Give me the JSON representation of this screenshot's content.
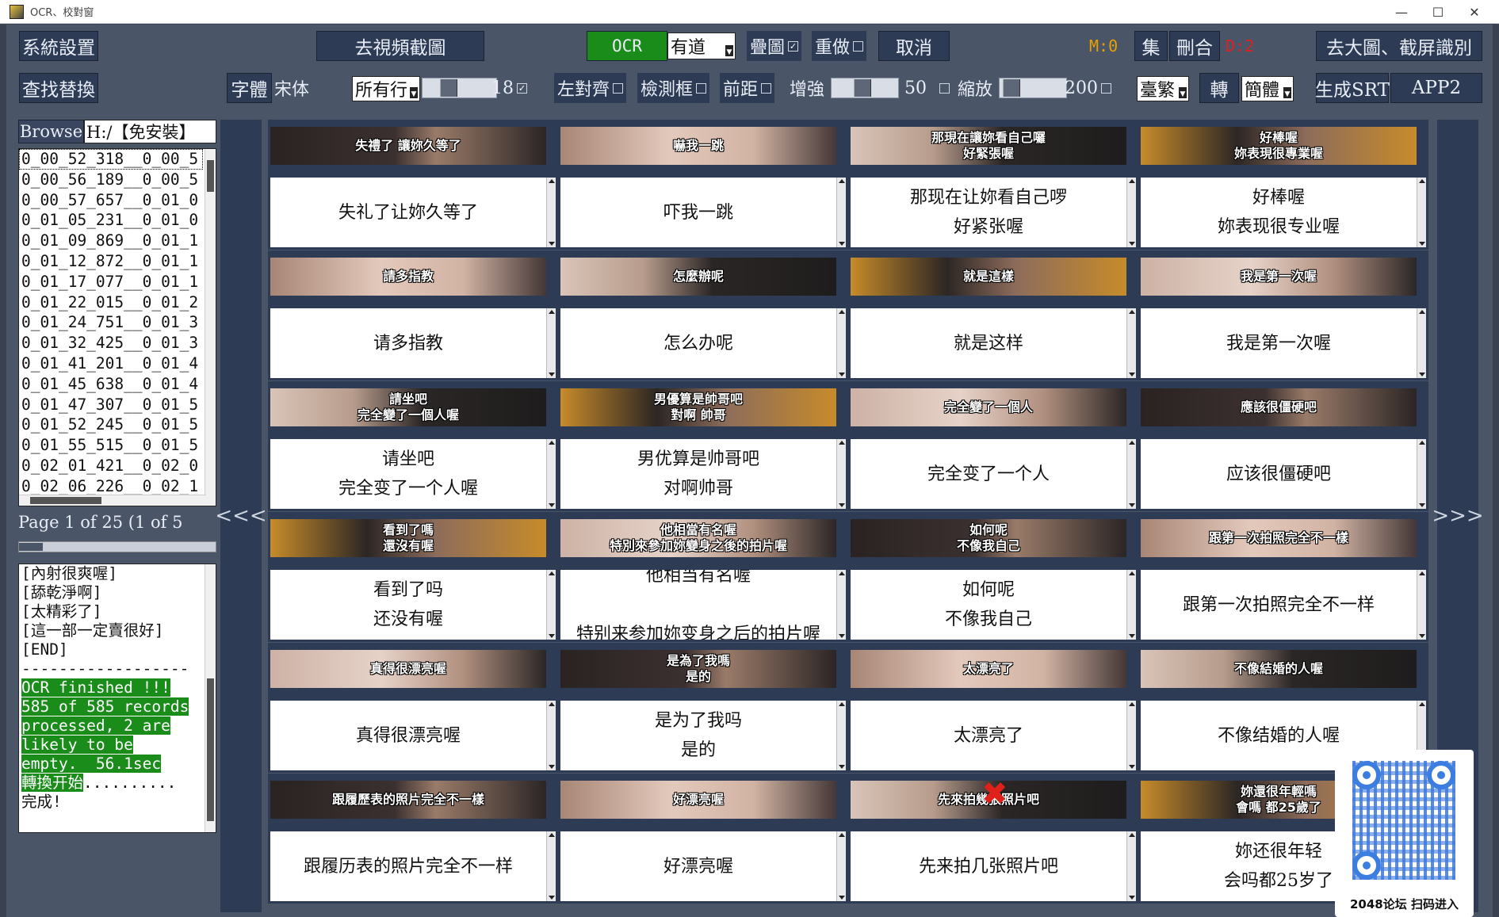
{
  "window": {
    "title": "OCR、校對窗",
    "minimize": "—",
    "maximize": "☐",
    "close": "✕"
  },
  "toolbar1": {
    "system_settings": "系統設置",
    "video_capture": "去視頻截圖",
    "ocr": "OCR",
    "engine_value": "有道",
    "overlay_label": "疊圖",
    "redo_label": "重做",
    "cancel": "取消",
    "m_counter": "M:0",
    "collect": "集",
    "delete_merge": "刪合",
    "d_counter": "D:2",
    "large_image": "去大圖、截屏識別"
  },
  "toolbar2": {
    "find_replace": "查找替換",
    "font_label": "字體",
    "font_value": "宋体",
    "lines_value": "所有行",
    "font_size": "18",
    "align_left": "左對齊",
    "detect_box": "檢測框",
    "front_distance": "前距",
    "enhance": "增強",
    "enhance_value": "50",
    "zoom": "縮放",
    "zoom_value": "200",
    "trad_value": "臺繁",
    "convert": "轉",
    "simp_value": "簡體",
    "gen_srt": "生成SRT",
    "app2": "APP2"
  },
  "left_panel": {
    "browse": "Browse",
    "path": "H:/【免安裝】",
    "files": [
      "0_00_52_318__0_00_5",
      "0_00_56_189__0_00_5",
      "0_00_57_657__0_01_0",
      "0_01_05_231__0_01_0",
      "0_01_09_869__0_01_1",
      "0_01_12_872__0_01_1",
      "0_01_17_077__0_01_1",
      "0_01_22_015__0_01_2",
      "0_01_24_751__0_01_3",
      "0_01_32_425__0_01_3",
      "0_01_41_201__0_01_4",
      "0_01_45_638__0_01_4",
      "0_01_47_307__0_01_5",
      "0_01_52_245__0_01_5",
      "0_01_55_515__0_01_5",
      "0_02_01_421__0_02_0",
      "0_02_06_226__0_02_1",
      "0_02_12_165__0_02_1",
      "0_02_21_975__0_02_2",
      "0_02_27_447__0_02_2",
      "0_02_32_051__0_02_3"
    ],
    "page_info": "Page 1 of 25 (1 of 5",
    "log": [
      "[內射很爽喔]",
      "[舔乾淨啊]",
      "[太精彩了]",
      "[這一部一定賣很好]",
      "[END]",
      "------------------"
    ],
    "log_highlight": [
      "OCR finished !!!",
      "585 of 585 records",
      "processed, 2 are",
      "likely to be",
      "empty.  56.1sec",
      "轉換开始"
    ],
    "log_tail_dots": "..........",
    "log_done": "完成!"
  },
  "nav": {
    "prev": "<<<",
    "next": ">>>"
  },
  "cells": [
    {
      "thumb": "失禮了 讓妳久等了",
      "text": "失礼了让妳久等了"
    },
    {
      "thumb": "嚇我一跳",
      "text": "吓我一跳"
    },
    {
      "thumb": "那現在讓妳看自己囉\n好緊張喔",
      "text": "那现在让妳看自己啰\n好紧张喔"
    },
    {
      "thumb": "好棒喔\n妳表現很專業喔",
      "text": "好棒喔\n妳表现很专业喔"
    },
    {
      "thumb": "請多指教",
      "text": "请多指教"
    },
    {
      "thumb": "怎麼辦呢",
      "text": "怎么办呢"
    },
    {
      "thumb": "就是這樣",
      "text": "就是这样"
    },
    {
      "thumb": "我是第一次喔",
      "text": "我是第一次喔"
    },
    {
      "thumb": "請坐吧\n完全變了一個人喔",
      "text": "请坐吧\n完全变了一个人喔"
    },
    {
      "thumb": "男優算是帥哥吧\n對啊 帥哥",
      "text": "男优算是帅哥吧\n对啊帅哥"
    },
    {
      "thumb": "完全變了一個人",
      "text": "完全变了一个人"
    },
    {
      "thumb": "應該很僵硬吧",
      "text": "应该很僵硬吧"
    },
    {
      "thumb": "看到了嗎\n還沒有喔",
      "text": "看到了吗\n还没有喔"
    },
    {
      "thumb": "他相當有名喔\n特別來參加妳變身之後的拍片喔",
      "text": "他相当有名喔\n\n特别来参加妳变身之后的拍片喔"
    },
    {
      "thumb": "如何呢\n不像我自己",
      "text": "如何呢\n不像我自己"
    },
    {
      "thumb": "跟第一次拍照完全不一樣",
      "text": "跟第一次拍照完全不一样"
    },
    {
      "thumb": "真得很漂亮喔",
      "text": "真得很漂亮喔"
    },
    {
      "thumb": "是為了我嗎\n是的",
      "text": "是为了我吗\n是的"
    },
    {
      "thumb": "太漂亮了",
      "text": "太漂亮了"
    },
    {
      "thumb": "不像結婚的人喔",
      "text": "不像结婚的人喔"
    },
    {
      "thumb": "跟履歷表的照片完全不一樣",
      "text": "跟履历表的照片完全不一样"
    },
    {
      "thumb": "好漂亮喔",
      "text": "好漂亮喔"
    },
    {
      "thumb": "先來拍幾張照片吧",
      "text": "先来拍几张照片吧"
    },
    {
      "thumb": "妳還很年輕嗎\n會嗎 都25歲了",
      "text": "妳还很年轻\n会吗都25岁了"
    }
  ],
  "qr": {
    "caption": "2048论坛 扫码进入"
  },
  "colors": {
    "ocr_green": "#1a8c1a",
    "counter_orange": "#e8a000",
    "counter_red": "#e02020",
    "panel_blue": "#2d3b55"
  }
}
